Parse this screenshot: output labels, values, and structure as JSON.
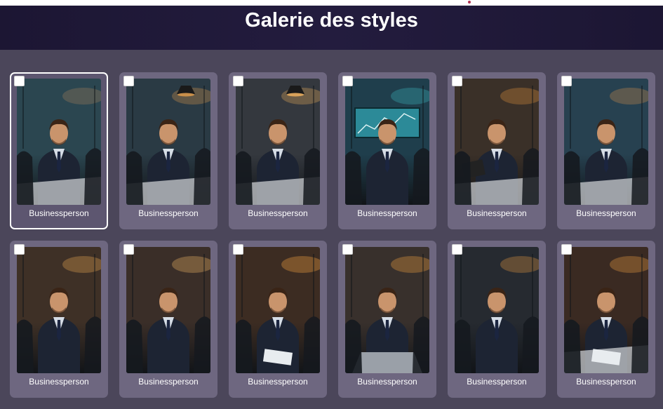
{
  "page": {
    "title": "Galerie des styles"
  },
  "gallery": {
    "items": [
      {
        "label": "Businessperson",
        "selected": true,
        "bg": "#2b4650",
        "accent": "#9a7a5a",
        "icon": "meeting-table"
      },
      {
        "label": "Businessperson",
        "selected": false,
        "bg": "#2a3a44",
        "accent": "#c98f4a",
        "icon": "meeting-charts"
      },
      {
        "label": "Businessperson",
        "selected": false,
        "bg": "#34383e",
        "accent": "#d9a25a",
        "icon": "meeting-lamps"
      },
      {
        "label": "Businessperson",
        "selected": false,
        "bg": "#1f3e4c",
        "accent": "#3ab0b8",
        "icon": "presentation-screen"
      },
      {
        "label": "Businessperson",
        "selected": false,
        "bg": "#3a3028",
        "accent": "#d48a3a",
        "icon": "tablet-meeting"
      },
      {
        "label": "Businessperson",
        "selected": false,
        "bg": "#274150",
        "accent": "#c2874a",
        "icon": "conference-room"
      },
      {
        "label": "Businessperson",
        "selected": false,
        "bg": "#3e3026",
        "accent": "#e0a050",
        "icon": "handshake"
      },
      {
        "label": "Businessperson",
        "selected": false,
        "bg": "#3a2e28",
        "accent": "#e8b060",
        "icon": "business-card"
      },
      {
        "label": "Businessperson",
        "selected": false,
        "bg": "#3c2c22",
        "accent": "#f0a040",
        "icon": "documents-crowd"
      },
      {
        "label": "Businessperson",
        "selected": false,
        "bg": "#38302c",
        "accent": "#e89a40",
        "icon": "laptop"
      },
      {
        "label": "Businessperson",
        "selected": false,
        "bg": "#262a30",
        "accent": "#d89040",
        "icon": "camera-crew"
      },
      {
        "label": "Businessperson",
        "selected": false,
        "bg": "#3a2a22",
        "accent": "#e49840",
        "icon": "signing-document"
      }
    ]
  }
}
